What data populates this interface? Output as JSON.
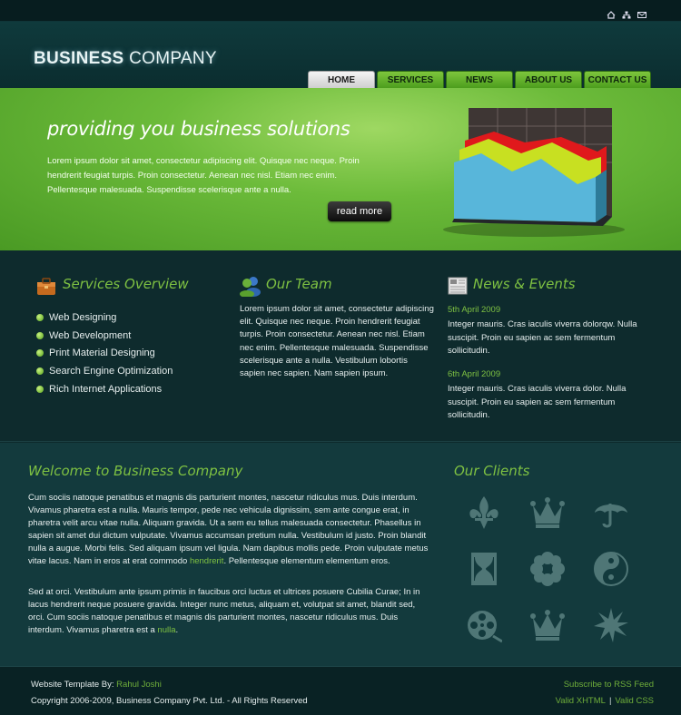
{
  "colors": {
    "accent": "#7ec142",
    "bg": "#0d2a2c",
    "hero": "#6cbb3a"
  },
  "top_icons": [
    "home-icon",
    "sitemap-icon",
    "mail-icon"
  ],
  "logo": {
    "bold": "BUSINESS",
    "light": " COMPANY"
  },
  "nav": [
    "HOME",
    "SERVICES",
    "NEWS",
    "ABOUT US",
    "CONTACT US"
  ],
  "hero": {
    "title": "providing you business solutions",
    "text": "Lorem ipsum dolor sit amet, consectetur adipiscing elit. Quisque nec neque. Proin hendrerit feugiat turpis. Proin consectetur. Aenean nec nisl. Etiam nec enim. Pellentesque malesuada. Suspendisse scelerisque ante a nulla.",
    "button": "read more"
  },
  "services": {
    "title": "Services Overview",
    "items": [
      "Web Designing",
      "Web Development",
      "Print Material Designing",
      "Search Engine Optimization",
      "Rich Internet Applications"
    ]
  },
  "team": {
    "title": "Our Team",
    "text": "Lorem ipsum dolor sit amet, consectetur adipiscing elit. Quisque nec neque. Proin hendrerit feugiat turpis. Proin consectetur. Aenean nec nisl. Etiam nec enim. Pellentesque malesuada. Suspendisse scelerisque ante a nulla. Vestibulum lobortis sapien nec sapien. Nam sapien ipsum."
  },
  "news": {
    "title": "News & Events",
    "items": [
      {
        "date": "5th April 2009",
        "text": "Integer mauris. Cras iaculis viverra dolorqw. Nulla suscipit. Proin eu sapien ac sem fermentum sollicitudin."
      },
      {
        "date": "6th April 2009",
        "text": "Integer mauris. Cras iaculis viverra dolor. Nulla suscipit. Proin eu sapien ac sem fermentum sollicitudin."
      }
    ]
  },
  "welcome": {
    "title": "Welcome to Business Company",
    "p1": "Cum sociis natoque penatibus et magnis dis parturient montes, nascetur ridiculus mus. Duis interdum. Vivamus pharetra est a nulla. Mauris tempor, pede nec vehicula dignissim, sem ante congue erat, in pharetra velit arcu vitae nulla. Aliquam gravida. Ut a sem eu tellus malesuada consectetur. Phasellus in sapien sit amet dui dictum vulputate. Vivamus accumsan pretium nulla. Vestibulum id justo. Proin blandit nulla a augue. Morbi felis. Sed aliquam ipsum vel ligula. Nam dapibus mollis pede. Proin vulputate metus vitae lacus. Nam in eros at erat commodo ",
    "p1_link": "hendrerit",
    "p1_end": ". Pellentesque elementum elementum eros.",
    "p2": "Sed at orci. Vestibulum ante ipsum primis in faucibus orci luctus et ultrices posuere Cubilia Curae; In in lacus hendrerit neque posuere gravida. Integer nunc metus, aliquam et, volutpat sit amet, blandit sed, orci. Cum sociis natoque penatibus et magnis dis parturient montes, nascetur ridiculus mus. Duis interdum. Vivamus pharetra est a ",
    "p2_link": "nulla",
    "p2_end": "."
  },
  "clients": {
    "title": "Our Clients",
    "icons": [
      "fleur-de-lis-icon",
      "crown-icon",
      "umbrella-icon",
      "hourglass-icon",
      "flower-icon",
      "yin-yang-icon",
      "film-reel-icon",
      "crown-icon",
      "star-burst-icon"
    ]
  },
  "footer": {
    "template_by": "Website Template By:",
    "author": "Rahul Joshi",
    "copyright": "Copyright 2006-2009, Business Company Pvt. Ltd. - All Rights Reserved",
    "rss": "Subscribe to RSS Feed",
    "xhtml": "Valid XHTML",
    "sep": "|",
    "css": "Valid CSS"
  }
}
